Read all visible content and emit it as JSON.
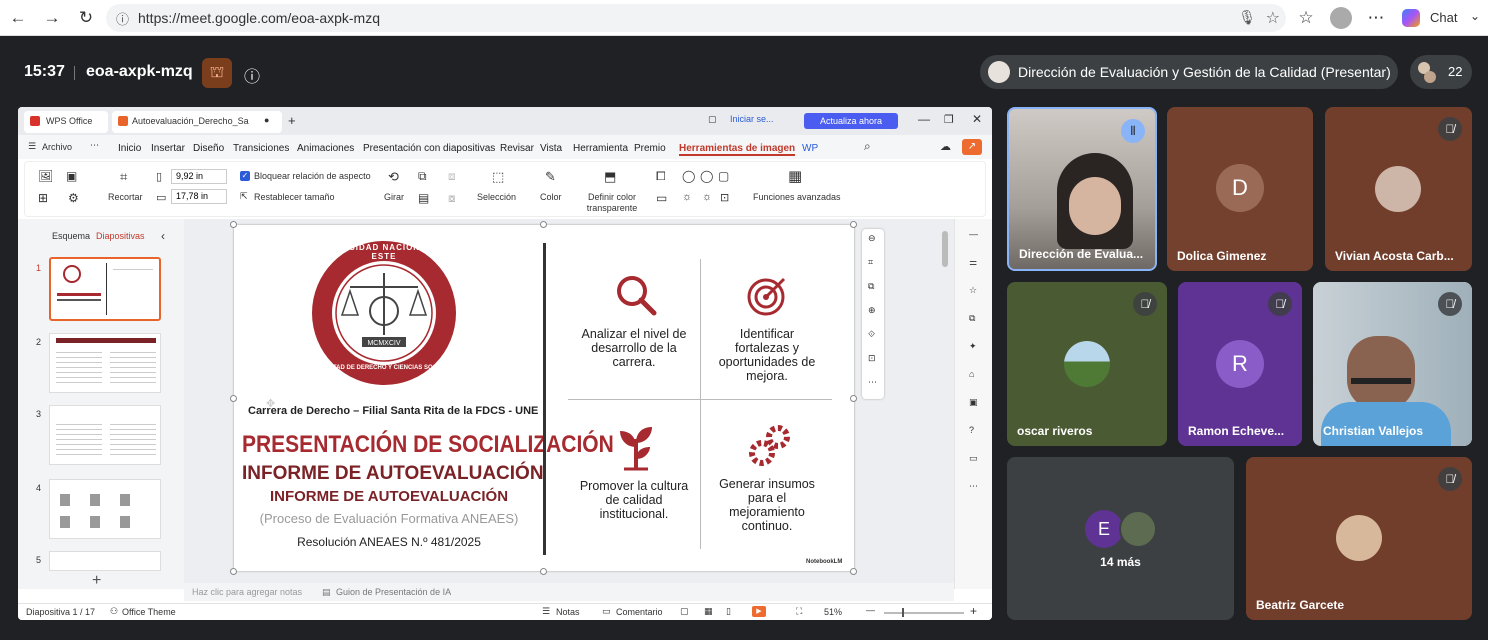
{
  "browser": {
    "url": "https://meet.google.com/eoa-axpk-mzq",
    "chat_label": "Chat"
  },
  "meet": {
    "time": "15:37",
    "meeting_code": "eoa-axpk-mzq",
    "presenter_label": "Dirección de Evaluación y Gestión de la Calidad (Presentar)",
    "participant_count": "22"
  },
  "wps": {
    "app_tab": "WPS Office",
    "doc_tab": "Autoevaluación_Derecho_Sa",
    "login": "Iniciar se...",
    "update_btn": "Actualiza ahora",
    "archivo": "Archivo",
    "ribbon_tabs": [
      "Inicio",
      "Insertar",
      "Diseño",
      "Transiciones",
      "Animaciones",
      "Presentación con diapositivas",
      "Revisar",
      "Vista",
      "Herramienta",
      "Premio",
      "Herramientas de imagen",
      "WP"
    ],
    "width_val": "9,92 in",
    "height_val": "17,78 in",
    "lock_ratio": "Bloquear relación de aspecto",
    "reset_size": "Restablecer tamaño",
    "crop": "Recortar",
    "rotate": "Girar",
    "selection": "Selección",
    "color": "Color",
    "transparent": "Definir color transparente",
    "advanced": "Funciones avanzadas",
    "panel_tabs": [
      "Esquema",
      "Diapositivas"
    ],
    "slide_numbers": [
      "1",
      "2",
      "3",
      "4",
      "5"
    ],
    "notes_placeholder": "Haz clic para agregar notas",
    "ai_guide": "Guion de Presentación de IA",
    "status_slide": "Diapositiva 1 / 17",
    "status_theme": "Office Theme",
    "status_notes": "Notas",
    "status_comment": "Comentario",
    "zoom": "51%"
  },
  "slide": {
    "seal_top": "UNIVERSIDAD NACIONAL DEL ESTE",
    "seal_bottom": "FACULTAD DE DERECHO Y CIENCIAS SOCIALES",
    "seal_year": "MCMXCIV",
    "subtitle": "Carrera de Derecho – Filial Santa Rita de la FDCS - UNE",
    "title1": "PRESENTACIÓN DE SOCIALIZACIÓN",
    "title2": "INFORME DE AUTOEVALUACIÓN",
    "title3": "INFORME DE AUTOEVALUACIÓN",
    "process": "(Proceso de Evaluación Formativa ANEAES)",
    "resolution": "Resolución ANEAES N.º 481/2025",
    "q1": "Analizar el nivel de desarrollo de la carrera.",
    "q2": "Identificar fortalezas y oportunidades de mejora.",
    "q3": "Promover la cultura de calidad institucional.",
    "q4": "Generar insumos para el mejoramiento continuo.",
    "watermark": "NotebookLM"
  },
  "participants": {
    "p1": "Dirección de Evalua...",
    "p2": "Dolica Gimenez",
    "p2_initial": "D",
    "p3": "Vivian Acosta Carb...",
    "p4": "oscar riveros",
    "p5": "Ramon Echeve...",
    "p5_initial": "R",
    "p6": "Christian Vallejos",
    "more_initial": "E",
    "more": "14 más",
    "p7": "Beatriz Garcete"
  },
  "colors": {
    "accent_red": "#a62a2f",
    "update_btn": "#4a5df0"
  }
}
